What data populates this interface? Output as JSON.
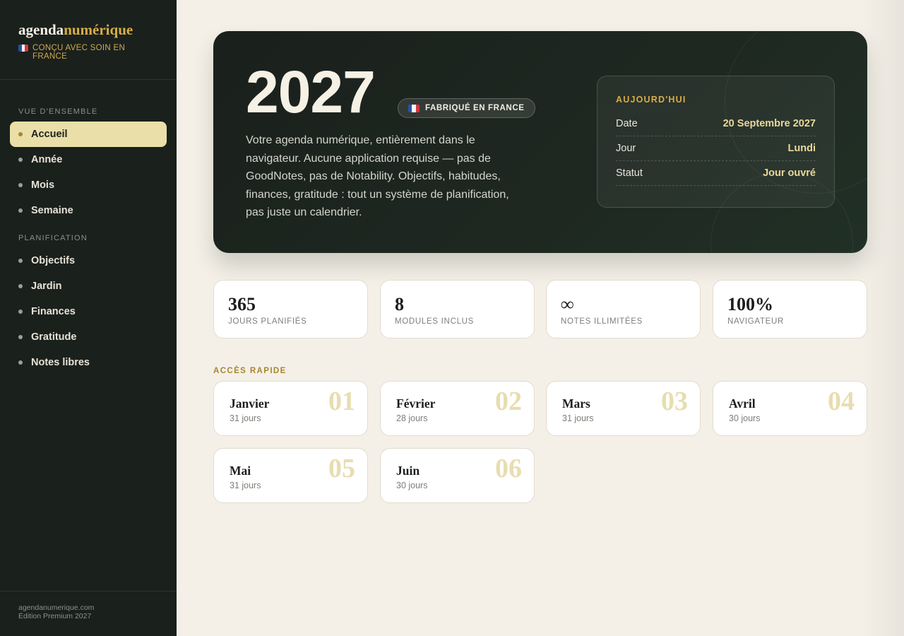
{
  "brand": {
    "name_part1": "agenda",
    "name_part2": "numérique",
    "tagline": "CONÇU AVEC SOIN EN FRANCE"
  },
  "sidebar": {
    "section_overview": "VUE D'ENSEMBLE",
    "section_planning": "PLANIFICATION",
    "overview_items": [
      {
        "label": "Accueil",
        "active": true
      },
      {
        "label": "Année"
      },
      {
        "label": "Mois"
      },
      {
        "label": "Semaine"
      }
    ],
    "planning_items": [
      {
        "label": "Objectifs"
      },
      {
        "label": "Jardin"
      },
      {
        "label": "Finances"
      },
      {
        "label": "Gratitude"
      },
      {
        "label": "Notes libres"
      }
    ],
    "footer_line1": "agendanumerique.com",
    "footer_line2": "Édition Premium 2027"
  },
  "hero": {
    "year": "2027",
    "badge": "FABRIQUÉ EN FRANCE",
    "description": "Votre agenda numérique, entièrement dans le navigateur. Aucune application requise — pas de GoodNotes, pas de Notability. Objectifs, habitudes, finances, gratitude : tout un système de planification, pas juste un calendrier.",
    "today": {
      "title": "AUJOURD'HUI",
      "rows": [
        {
          "key": "Date",
          "value": "20 Septembre 2027"
        },
        {
          "key": "Jour",
          "value": "Lundi"
        },
        {
          "key": "Statut",
          "value": "Jour ouvré"
        }
      ]
    }
  },
  "stats": [
    {
      "value": "365",
      "label": "JOURS PLANIFIÉS"
    },
    {
      "value": "8",
      "label": "MODULES INCLUS"
    },
    {
      "value": "∞",
      "label": "NOTES ILLIMITÉES"
    },
    {
      "value": "100%",
      "label": "NAVIGATEUR"
    }
  ],
  "quick_access": {
    "title": "ACCÈS RAPIDE",
    "months": [
      {
        "name": "Janvier",
        "days": "31 jours",
        "number": "01"
      },
      {
        "name": "Février",
        "days": "28 jours",
        "number": "02"
      },
      {
        "name": "Mars",
        "days": "31 jours",
        "number": "03"
      },
      {
        "name": "Avril",
        "days": "30 jours",
        "number": "04"
      },
      {
        "name": "Mai",
        "days": "31 jours",
        "number": "05"
      },
      {
        "name": "Juin",
        "days": "30 jours",
        "number": "06"
      }
    ]
  },
  "colors": {
    "sidebar_bg": "#1a201c",
    "accent_gold": "#d7ad46",
    "active_nav_bg": "#eadfa8",
    "page_bg": "#f4f0e8"
  }
}
